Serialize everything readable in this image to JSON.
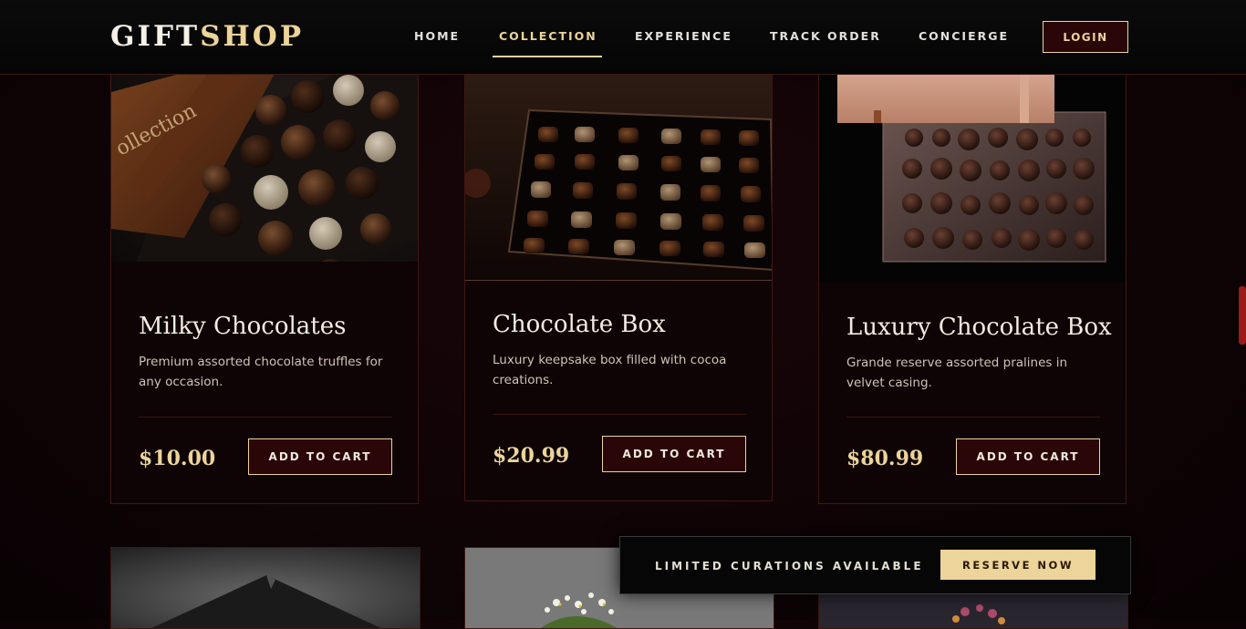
{
  "brand": {
    "part1": "GIFT",
    "part2": "SHOP"
  },
  "nav": {
    "items": [
      {
        "label": "HOME"
      },
      {
        "label": "COLLECTION",
        "active": true
      },
      {
        "label": "EXPERIENCE"
      },
      {
        "label": "TRACK ORDER"
      },
      {
        "label": "CONCIERGE"
      }
    ],
    "login_label": "LOGIN"
  },
  "products": [
    {
      "name": "Milky Chocolates",
      "description": "Premium assorted chocolate truffles for any occasion.",
      "price": "$10.00",
      "cta": "ADD TO CART"
    },
    {
      "name": "Chocolate Box",
      "description": "Luxury keepsake box filled with cocoa creations.",
      "price": "$20.99",
      "cta": "ADD TO CART"
    },
    {
      "name": "Luxury Chocolate Box",
      "description": "Grande reserve assorted pralines in velvet casing.",
      "price": "$80.99",
      "cta": "ADD TO CART"
    }
  ],
  "banner": {
    "text": "LIMITED CURATIONS AVAILABLE",
    "cta": "RESERVE NOW"
  },
  "colors": {
    "accent_gold": "#ecd49a",
    "burgundy": "#2a0608",
    "background": "#0e0305",
    "scrollbar": "#9b1a1a"
  }
}
